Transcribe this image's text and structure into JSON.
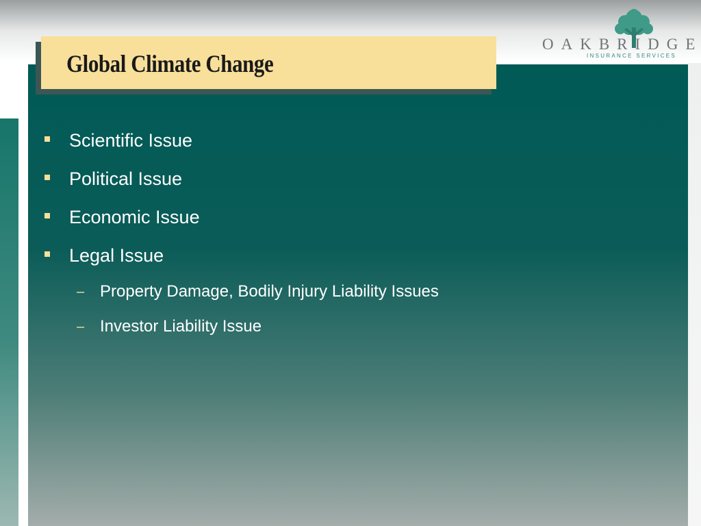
{
  "slide": {
    "title": "Global Climate Change"
  },
  "logo": {
    "wordmark": "OAKBRIDGE",
    "tagline": "INSURANCE SERVICES",
    "icon": "oak-tree-icon"
  },
  "bullets": [
    {
      "level": 1,
      "text": "Scientific Issue"
    },
    {
      "level": 1,
      "text": "Political Issue"
    },
    {
      "level": 1,
      "text": "Economic Issue"
    },
    {
      "level": 1,
      "text": "Legal Issue"
    },
    {
      "level": 2,
      "text": "Property Damage, Bodily Injury Liability Issues"
    },
    {
      "level": 2,
      "text": "Investor Liability Issue"
    }
  ],
  "colors": {
    "panel": "#005a56",
    "title_fill": "#f8df9a",
    "bullet_marker": "#f8df9a",
    "logo_text": "#6f7476",
    "logo_accent": "#2f8a7c"
  }
}
